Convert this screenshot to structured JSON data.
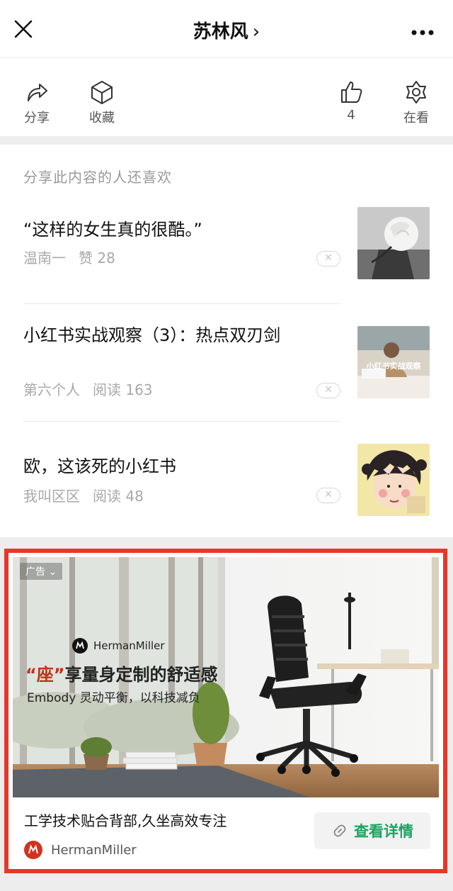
{
  "header": {
    "title": "苏林风",
    "chevron": "›"
  },
  "actions": {
    "share": {
      "label": "分享",
      "icon": "share-arrow-icon"
    },
    "favorite": {
      "label": "收藏",
      "icon": "cube-icon"
    },
    "like": {
      "label": "4",
      "icon": "thumbs-up-icon"
    },
    "watching": {
      "label": "在看",
      "icon": "flower-icon"
    }
  },
  "recommendations": {
    "title": "分享此内容的人还喜欢",
    "items": [
      {
        "title": "“这样的女生真的很酷。”",
        "author": "温南一",
        "stat": "赞 28",
        "thumb": "white-rose"
      },
      {
        "title": "小红书实战观察（3）：热点双刃剑",
        "author": "第六个人",
        "stat": "阅读 163",
        "thumb_text": "小红书实战观察"
      },
      {
        "title": "欧，这该死的小红书",
        "author": "我叫区区",
        "stat": "阅读 48",
        "thumb": "cartoon-girl"
      }
    ]
  },
  "ad": {
    "tag": "广告",
    "brand_badge": "HermanMiller",
    "headline_highlight": "“座”",
    "headline_rest": "享量身定制的舒适感",
    "subline": "Embody 灵动平衡，以科技减负",
    "text": "工学技术贴合背部,久坐高效专注",
    "cta_label": "查看详情",
    "advertiser": "HermanMiller"
  },
  "colors": {
    "accent_green": "#1aa260",
    "ad_border_red": "#e7372a",
    "brand_red": "#d3321f"
  }
}
